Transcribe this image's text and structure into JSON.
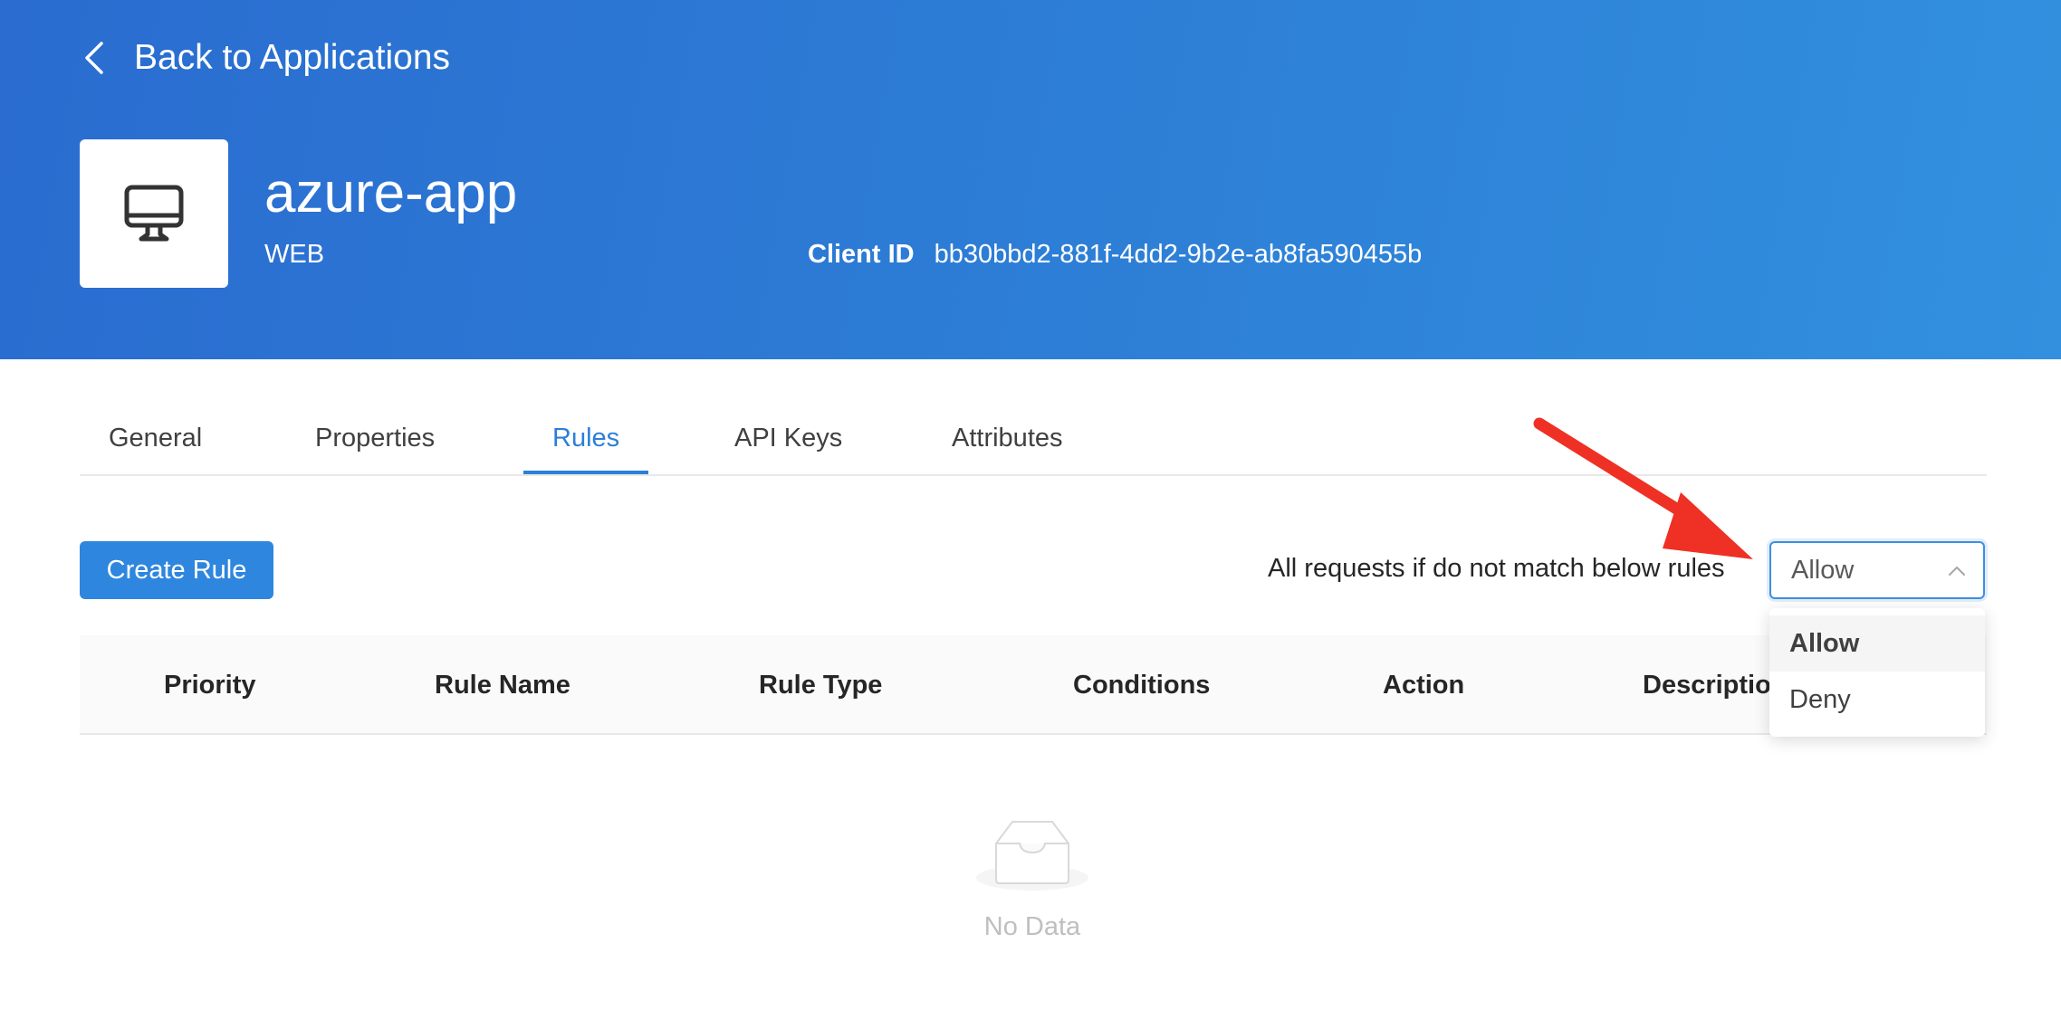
{
  "header": {
    "back_label": "Back to Applications",
    "app_name": "azure-app",
    "app_type": "WEB",
    "client_id_label": "Client ID",
    "client_id_value": "bb30bbd2-881f-4dd2-9b2e-ab8fa590455b",
    "app_icon": "desktop-icon"
  },
  "tabs": [
    {
      "label": "General",
      "active": false
    },
    {
      "label": "Properties",
      "active": false
    },
    {
      "label": "Rules",
      "active": true
    },
    {
      "label": "API Keys",
      "active": false
    },
    {
      "label": "Attributes",
      "active": false
    }
  ],
  "toolbar": {
    "create_rule_label": "Create Rule",
    "default_action_label": "All requests if do not match below rules",
    "default_action_value": "Allow"
  },
  "dropdown": {
    "options": [
      {
        "label": "Allow",
        "selected": true
      },
      {
        "label": "Deny",
        "selected": false
      }
    ]
  },
  "table": {
    "columns": [
      "Priority",
      "Rule Name",
      "Rule Type",
      "Conditions",
      "Action",
      "Description"
    ],
    "empty_text": "No Data"
  },
  "colors": {
    "header_gradient_start": "#2a6cd0",
    "header_gradient_end": "#3290df",
    "accent": "#2e86de",
    "annotation_arrow": "#ee3124"
  }
}
